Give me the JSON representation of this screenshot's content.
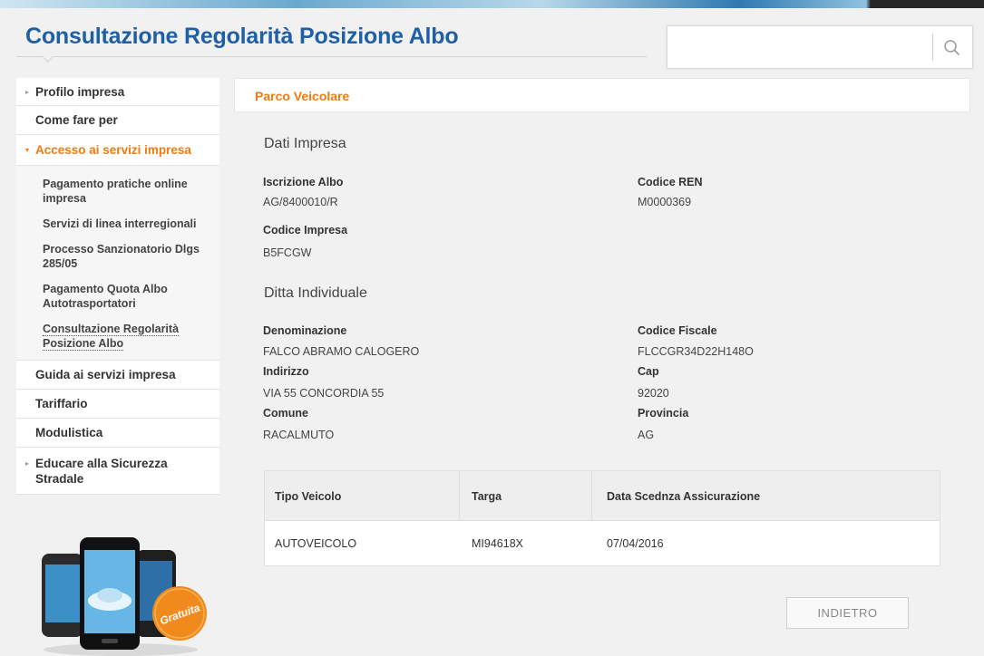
{
  "page": {
    "title": "Consultazione Regolarità Posizione Albo"
  },
  "search": {
    "value": "",
    "placeholder": "",
    "icon": "search-icon"
  },
  "sidebar": {
    "items": [
      {
        "label": "Profilo impresa",
        "caret": "▸"
      },
      {
        "label": "Come fare per",
        "caret": ""
      },
      {
        "label": "Accesso ai servizi impresa",
        "caret": "▾"
      },
      {
        "label": "Guida ai servizi impresa",
        "caret": ""
      },
      {
        "label": "Tariffario",
        "caret": ""
      },
      {
        "label": "Modulistica",
        "caret": ""
      },
      {
        "label": "Educare alla Sicurezza Stradale",
        "caret": "▸"
      }
    ],
    "subitems": [
      "Pagamento pratiche online impresa",
      "Servizi di linea interregionali",
      "Processo Sanzionatorio Dlgs 285/05",
      "Pagamento Quota Albo Autotrasportatori",
      "Consultazione Regolarità Posizione Albo"
    ]
  },
  "promo": {
    "badge": "Gratuita"
  },
  "main": {
    "header": "Parco Veicolare",
    "dati_impresa": {
      "title": "Dati Impresa",
      "iscrizione_label": "Iscrizione Albo",
      "iscrizione_value": "AG/8400010/R",
      "ren_label": "Codice REN",
      "ren_value": "M0000369",
      "codice_impresa_label": "Codice Impresa",
      "codice_impresa_value": "B5FCGW"
    },
    "ditta": {
      "title": "Ditta Individuale",
      "denominazione_label": "Denominazione",
      "denominazione_value": "FALCO ABRAMO CALOGERO",
      "cf_label": "Codice Fiscale",
      "cf_value": "FLCCGR34D22H148O",
      "indirizzo_label": "Indirizzo",
      "indirizzo_value": "VIA 55 CONCORDIA 55",
      "cap_label": "Cap",
      "cap_value": "92020",
      "comune_label": "Comune",
      "comune_value": "RACALMUTO",
      "provincia_label": "Provincia",
      "provincia_value": "AG"
    },
    "vehicles": {
      "headers": [
        "Tipo Veicolo",
        "Targa",
        "Data Scednza Assicurazione"
      ],
      "rows": [
        [
          "AUTOVEICOLO",
          "MI94618X",
          "07/04/2016"
        ]
      ]
    },
    "back_label": "INDIETRO"
  },
  "colors": {
    "title_blue": "#1f5fa5",
    "accent_orange": "#f07a10",
    "background": "#f1f1f1"
  }
}
